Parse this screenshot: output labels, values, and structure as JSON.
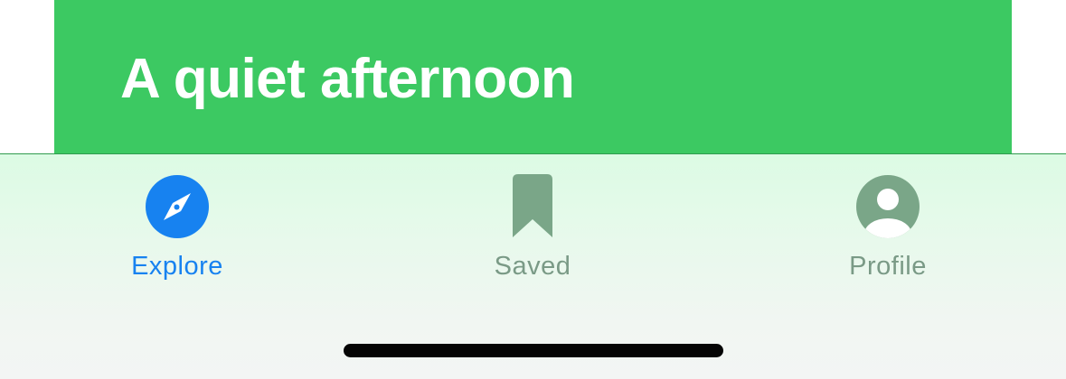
{
  "card": {
    "title": "A quiet afternoon"
  },
  "tabbar": {
    "selected": "Explore",
    "tabs": [
      {
        "label": "Explore",
        "icon": "compass-icon",
        "color": "#1782f0"
      },
      {
        "label": "Saved",
        "icon": "bookmark-icon",
        "color": "#7aa688"
      },
      {
        "label": "Profile",
        "icon": "person-icon",
        "color": "#7aa688"
      }
    ]
  },
  "colors": {
    "accent": "#1782f0",
    "card_background": "#3cc962",
    "inactive": "#7a9a86"
  }
}
